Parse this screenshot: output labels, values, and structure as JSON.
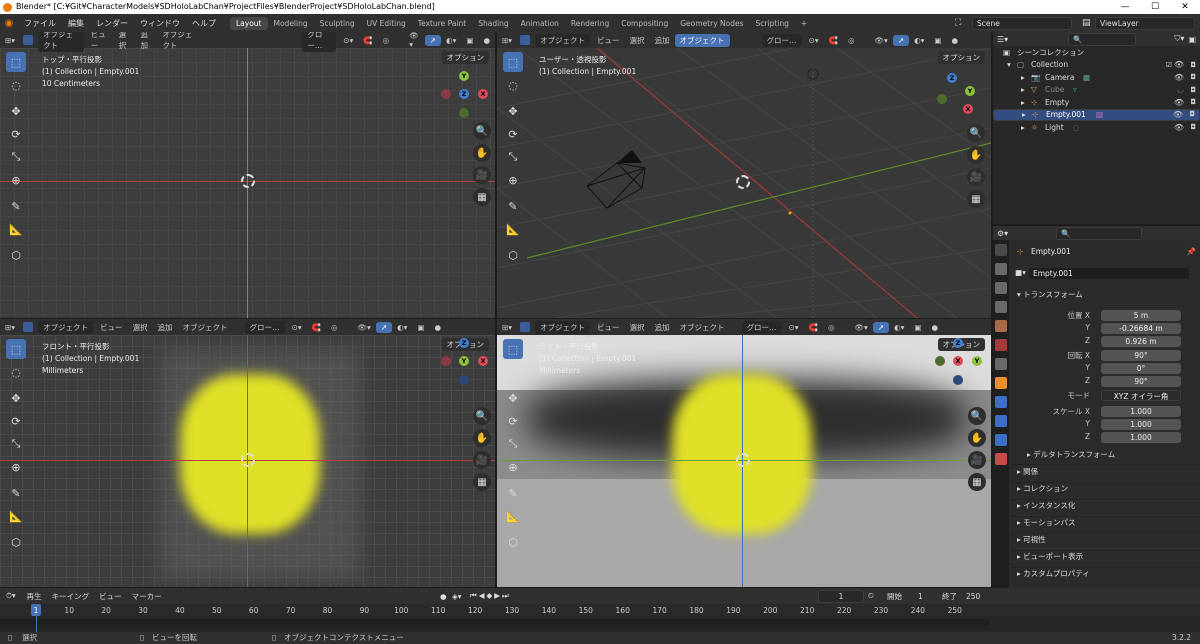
{
  "window": {
    "title": "Blender* [C:¥Git¥CharacterModels¥SDHoloLabChan¥ProjectFiles¥BlenderProject¥SDHoloLabChan.blend]"
  },
  "menu": {
    "items": [
      "ファイル",
      "編集",
      "レンダー",
      "ウィンドウ",
      "ヘルプ"
    ]
  },
  "workspaces": [
    "Layout",
    "Modeling",
    "Sculpting",
    "UV Editing",
    "Texture Paint",
    "Shading",
    "Animation",
    "Rendering",
    "Compositing",
    "Geometry Nodes",
    "Scripting"
  ],
  "active_workspace": "Layout",
  "scene": {
    "label": "Scene",
    "view_layer": "ViewLayer"
  },
  "viewport_header": {
    "mode": "オブジェクト",
    "view": "ビュー",
    "select": "選択",
    "add": "追加",
    "object": "オブジェクト",
    "orientation": "グロー…",
    "options": "オプション"
  },
  "viewports": [
    {
      "name": "top",
      "title": "トップ・平行投影",
      "collection": "(1) Collection | Empty.001",
      "scale": "10 Centimeters"
    },
    {
      "name": "user",
      "title": "ユーザー・透視投影",
      "collection": "(1) Collection | Empty.001",
      "scale": ""
    },
    {
      "name": "front",
      "title": "フロント・平行投影",
      "collection": "(1) Collection | Empty.001",
      "scale": "Millimeters"
    },
    {
      "name": "right",
      "title": "ライト・平行投影",
      "collection": "(1) Collection | Empty.001",
      "scale": "Millimeters"
    }
  ],
  "outliner": {
    "header": "シーンコレクション",
    "collection": "Collection",
    "items": [
      {
        "name": "Camera",
        "selected": false
      },
      {
        "name": "Cube",
        "selected": false
      },
      {
        "name": "Empty",
        "selected": false
      },
      {
        "name": "Empty.001",
        "selected": true
      },
      {
        "name": "Light",
        "selected": false
      }
    ]
  },
  "properties": {
    "object_name": "Empty.001",
    "data_name": "Empty.001",
    "transform_label": "トランスフォーム",
    "location_label": "位置 X",
    "location": {
      "x": "5 m",
      "y": "-0.26684 m",
      "z": "0.926 m"
    },
    "rotation_label": "回転 X",
    "rotation": {
      "x": "90°",
      "y": "0°",
      "z": "90°"
    },
    "mode_label": "モード",
    "rotation_mode": "XYZ オイラー角",
    "scale_label": "スケール X",
    "scale": {
      "x": "1.000",
      "y": "1.000",
      "z": "1.000"
    },
    "axis_y": "Y",
    "axis_z": "Z",
    "delta_transform": "デルタトランスフォーム",
    "sections": [
      "関係",
      "コレクション",
      "インスタンス化",
      "モーションパス",
      "可視性",
      "ビューポート表示",
      "カスタムプロパティ"
    ]
  },
  "timeline": {
    "playback": "再生",
    "keying": "キーイング",
    "view": "ビュー",
    "marker": "マーカー",
    "current_frame": "1",
    "start_label": "開始",
    "start": "1",
    "end_label": "終了",
    "end": "250",
    "ticks": [
      "1",
      "10",
      "20",
      "30",
      "40",
      "50",
      "60",
      "70",
      "80",
      "90",
      "100",
      "110",
      "120",
      "130",
      "140",
      "150",
      "160",
      "170",
      "180",
      "190",
      "200",
      "210",
      "220",
      "230",
      "240",
      "250"
    ]
  },
  "status": {
    "select": "選択",
    "rotate": "ビューを回転",
    "context": "オブジェクトコンテクストメニュー",
    "version": "3.2.2"
  }
}
